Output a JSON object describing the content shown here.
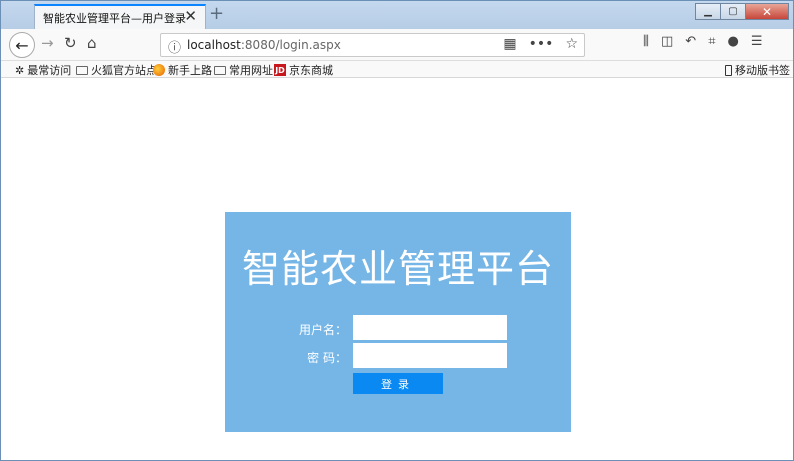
{
  "browser": {
    "tab_title": "智能农业管理平台—用户登录",
    "tab_close": "✕",
    "new_tab": "+",
    "url_host": "localhost",
    "url_rest": ":8080/login.aspx",
    "window_controls": {
      "minimize": "▁",
      "maximize": "▢",
      "close": "✕"
    }
  },
  "bookmarks": {
    "items": [
      {
        "label": "最常访问",
        "icon": "gear-icon"
      },
      {
        "label": "火狐官方站点",
        "icon": "folder-icon"
      },
      {
        "label": "新手上路",
        "icon": "firefox-icon"
      },
      {
        "label": "常用网址",
        "icon": "folder-icon"
      },
      {
        "label": "京东商城",
        "icon": "jd-icon"
      }
    ],
    "mobile": "移动版书签"
  },
  "login": {
    "title": "智能农业管理平台",
    "username_label": "用户名：",
    "password_label": "密 码：",
    "username_value": "",
    "password_value": "",
    "submit_label": "登录"
  },
  "colors": {
    "panel": "#75b6e7",
    "button": "#0b89f2",
    "accent": "#0a84ff"
  }
}
